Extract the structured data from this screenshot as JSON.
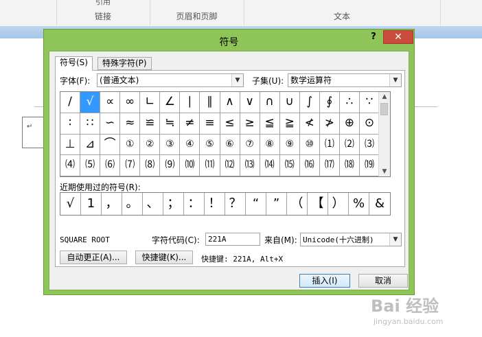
{
  "ribbon": {
    "groups": [
      {
        "label": "",
        "top": ""
      },
      {
        "label": "链接",
        "top": "引用"
      },
      {
        "label": "页眉和页脚",
        "top": ""
      },
      {
        "label": "文本",
        "top": ""
      },
      {
        "label": "",
        "top": ""
      }
    ]
  },
  "document": {
    "paragraph_mark": "↵"
  },
  "dialog": {
    "title": "符号",
    "help": "?",
    "close": "✕",
    "tabs": [
      "符号(S)",
      "特殊字符(P)"
    ],
    "font_label": "字体(F):",
    "font_value": "(普通文本)",
    "subset_label": "子集(U):",
    "subset_value": "数学运算符",
    "symbols": [
      "∕",
      "√",
      "∝",
      "∞",
      "∟",
      "∠",
      "∣",
      "∥",
      "∧",
      "∨",
      "∩",
      "∪",
      "∫",
      "∮",
      "∴",
      "∵",
      "∶",
      "∷",
      "∽",
      "≈",
      "≌",
      "≒",
      "≠",
      "≡",
      "≤",
      "≥",
      "≦",
      "≧",
      "≮",
      "≯",
      "⊕",
      "⊙",
      "⊥",
      "⊿",
      "⌒",
      "①",
      "②",
      "③",
      "④",
      "⑤",
      "⑥",
      "⑦",
      "⑧",
      "⑨",
      "⑩",
      "⑴",
      "⑵",
      "⑶",
      "⑷",
      "⑸",
      "⑹",
      "⑺",
      "⑻",
      "⑼",
      "⑽",
      "⑾",
      "⑿",
      "⒀",
      "⒁",
      "⒂",
      "⒃",
      "⒄",
      "⒅",
      "⒆"
    ],
    "recent_label": "近期使用过的符号(R):",
    "recent": [
      "√",
      "1",
      "，",
      "。",
      "、",
      "；",
      "：",
      "！",
      "？",
      "“",
      "”",
      "（",
      "【",
      "）",
      "%",
      "&"
    ],
    "char_name": "SQUARE ROOT",
    "char_code_label": "字符代码(C):",
    "char_code_value": "221A",
    "from_label": "来自(M):",
    "from_value": "Unicode(十六进制)",
    "autocorrect_button": "自动更正(A)...",
    "shortcut_button": "快捷键(K)...",
    "shortcut_text": "快捷键: 221A, Alt+X",
    "insert_button": "插入(I)",
    "cancel_button": "取消"
  },
  "watermark": {
    "main": "Bai 经验",
    "sub": "jingyan.baidu.com"
  }
}
